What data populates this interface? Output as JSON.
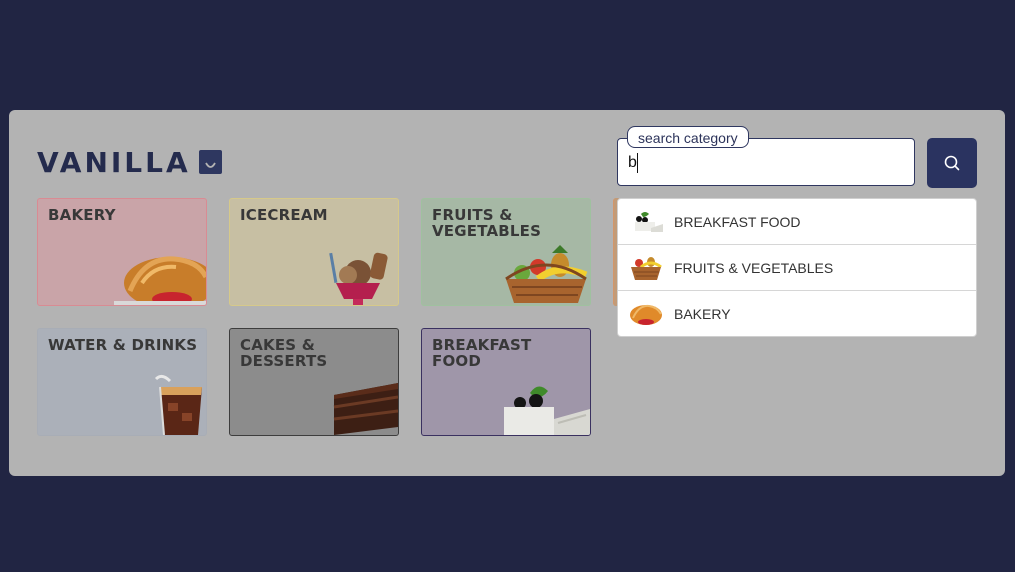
{
  "brand": {
    "title": "VANILLA",
    "icon": "shopping-bag-icon"
  },
  "colors": {
    "page_bg": "#212543",
    "accent": "#2a3360"
  },
  "categories": [
    {
      "label": "BAKERY",
      "icon": "croissant-image"
    },
    {
      "label": "ICECREAM",
      "icon": "ice-cream-sundae-image"
    },
    {
      "label": "FRUITS & VEGETABLES",
      "icon": "fruit-basket-image"
    },
    {
      "label": "WATER & DRINKS",
      "icon": "cola-glass-image"
    },
    {
      "label": "CAKES & DESSERTS",
      "icon": "chocolate-cake-slice-image"
    },
    {
      "label": "BREAKFAST FOOD",
      "icon": "breakfast-plate-image"
    }
  ],
  "search": {
    "legend": "search category",
    "value": "b",
    "button_icon": "search-icon"
  },
  "suggestions": [
    {
      "label": "BREAKFAST FOOD",
      "icon": "breakfast-plate-image"
    },
    {
      "label": "FRUITS & VEGETABLES",
      "icon": "fruit-basket-image"
    },
    {
      "label": "BAKERY",
      "icon": "croissant-image"
    }
  ]
}
